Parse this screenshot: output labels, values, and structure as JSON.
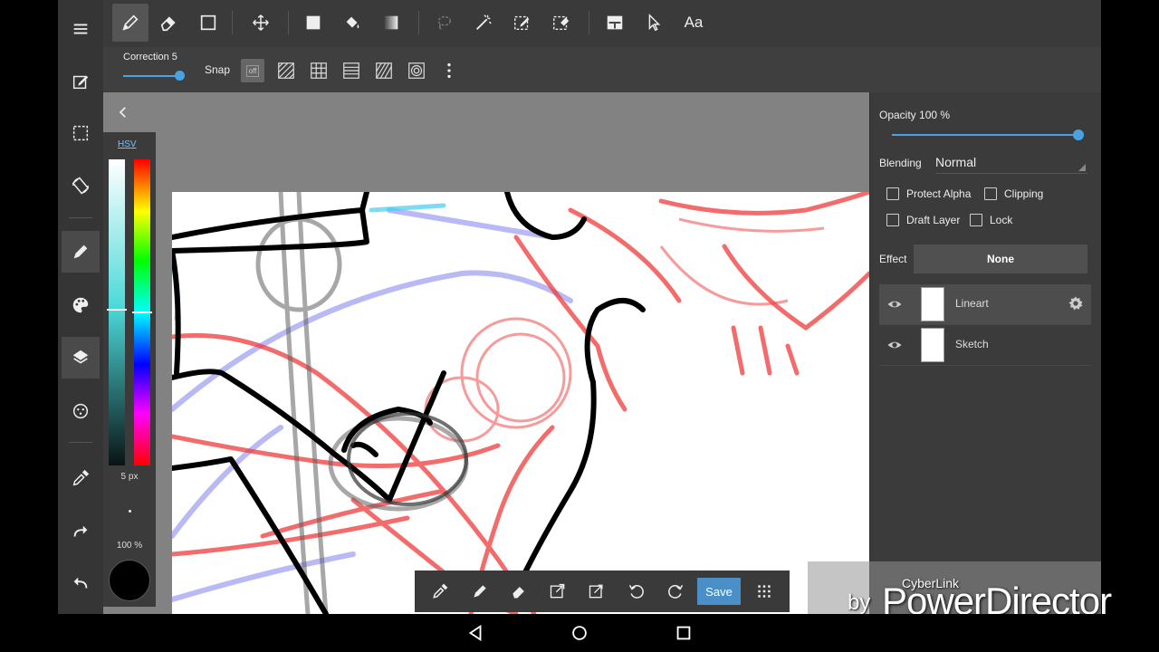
{
  "toolbar": {
    "tools": [
      {
        "name": "pen-tool",
        "icon": "pen-icon",
        "active": true
      },
      {
        "name": "eraser-tool",
        "icon": "eraser-icon"
      },
      {
        "name": "rectangle-tool",
        "icon": "rectangle-icon"
      },
      {
        "name": "move-tool",
        "icon": "move-icon"
      },
      {
        "name": "fill-rect-tool",
        "icon": "filled-square-icon"
      },
      {
        "name": "bucket-tool",
        "icon": "bucket-icon"
      },
      {
        "name": "gradient-tool",
        "icon": "gradient-icon"
      },
      {
        "name": "lasso-tool",
        "icon": "lasso-icon"
      },
      {
        "name": "magic-wand-tool",
        "icon": "magic-wand-icon"
      },
      {
        "name": "select-pen-tool",
        "icon": "select-pen-icon"
      },
      {
        "name": "select-eraser-tool",
        "icon": "select-eraser-icon"
      },
      {
        "name": "divide-tool",
        "icon": "divide-icon"
      },
      {
        "name": "operation-tool",
        "icon": "pointer-icon"
      }
    ],
    "text_tool_label": "Aa"
  },
  "subtoolbar": {
    "correction_label": "Correction 5",
    "correction_value": 5,
    "snap_label": "Snap",
    "snap_off_label": "off",
    "snap_modes": [
      "parallel-snap-icon",
      "grid-snap-icon",
      "horizontal-snap-icon",
      "vanishing-snap-icon",
      "concentric-snap-icon"
    ],
    "more_icon": "more-vert-icon"
  },
  "sidebar": {
    "items": [
      {
        "name": "menu",
        "icon": "menu-icon"
      },
      {
        "name": "edit",
        "icon": "edit-icon"
      },
      {
        "name": "selection",
        "icon": "selection-icon"
      },
      {
        "name": "rotate-view",
        "icon": "rotate-icon"
      },
      {
        "name": "brush",
        "icon": "brush-icon",
        "active": true
      },
      {
        "name": "color",
        "icon": "palette-icon"
      },
      {
        "name": "layer",
        "icon": "layers-icon",
        "active": true
      },
      {
        "name": "material",
        "icon": "material-icon"
      },
      {
        "name": "eyedropper",
        "icon": "eyedropper-icon"
      },
      {
        "name": "redo",
        "icon": "redo-icon"
      },
      {
        "name": "undo",
        "icon": "undo-icon"
      }
    ]
  },
  "color_panel": {
    "mode_label": "HSV",
    "brush_size_label": "5 px",
    "brush_opacity_label": "100 %",
    "current_color": "#000000"
  },
  "bottom_bar": {
    "buttons": [
      "eyedropper-icon",
      "pen-icon",
      "eraser-icon",
      "transform-icon",
      "export-icon",
      "rotate-left-icon",
      "rotate-right-icon"
    ],
    "save_label": "Save",
    "grid_icon": "apps-grid-icon"
  },
  "layer_panel": {
    "opacity_label": "Opacity 100 %",
    "opacity_value": 100,
    "blending_label": "Blending",
    "blending_value": "Normal",
    "protect_alpha_label": "Protect Alpha",
    "clipping_label": "Clipping",
    "draft_layer_label": "Draft Layer",
    "lock_label": "Lock",
    "effect_label": "Effect",
    "effect_value": "None",
    "layers": [
      {
        "name": "Lineart",
        "visible": true,
        "active": true
      },
      {
        "name": "Sketch",
        "visible": true,
        "active": false
      }
    ]
  },
  "watermark": {
    "brand_small": "CyberLink",
    "by": "by",
    "brand_big": "PowerDirector"
  },
  "colors": {
    "accent": "#4aa3e0",
    "save": "#4a8fc8",
    "sketch_red": "#f04040",
    "sketch_blue": "#7070f0"
  }
}
